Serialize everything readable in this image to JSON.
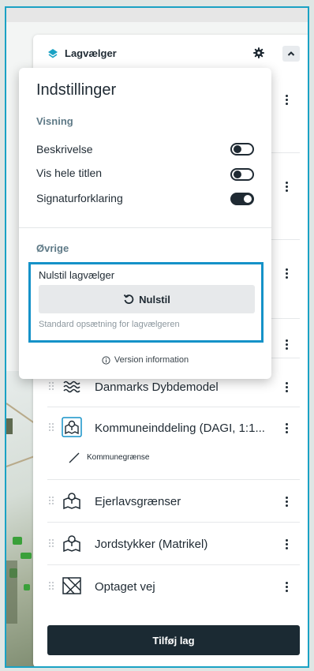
{
  "panel": {
    "title": "Lagvælger",
    "add_button": "Tilføj lag"
  },
  "settings": {
    "title": "Indstillinger",
    "display_section": "Visning",
    "options": [
      {
        "label": "Beskrivelse",
        "enabled": false
      },
      {
        "label": "Vis hele titlen",
        "enabled": false
      },
      {
        "label": "Signaturforklaring",
        "enabled": true
      }
    ],
    "other_section": "Øvrige",
    "reset_label": "Nulstil lagvælger",
    "reset_button": "Nulstil",
    "reset_help": "Standard opsætning for lagvælgeren",
    "version": "Version information"
  },
  "layers": [
    {
      "name": "Danmarks Dybdemodel",
      "icon": "waves-icon"
    },
    {
      "name": "Kommuneinddeling (DAGI, 1:1...",
      "icon": "map-pin-icon",
      "legend": "Kommunegrænse"
    },
    {
      "name": "Ejerlavsgrænser",
      "icon": "map-pin-icon"
    },
    {
      "name": "Jordstykker (Matrikel)",
      "icon": "map-pin-icon"
    },
    {
      "name": "Optaget vej",
      "icon": "map-road-icon"
    }
  ],
  "colors": {
    "accent": "#1592c8",
    "dark": "#1b2a33",
    "layers_icon": "#1aa2c4"
  }
}
